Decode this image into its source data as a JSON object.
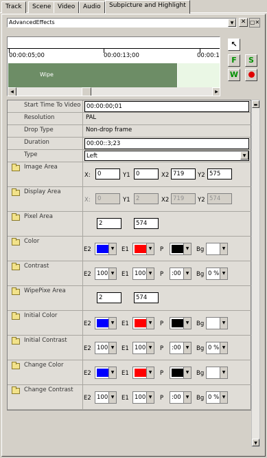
{
  "tabs": [
    "Track",
    "Scene",
    "Video",
    "Audio",
    "Subpicture and Highlight"
  ],
  "effect_select": "AdvancedEffects",
  "timeline": {
    "labels": [
      "00:00:05;00",
      "00:00:13;00",
      "00:00:1"
    ],
    "clip_label": "Wipe"
  },
  "tools": {
    "f": "F",
    "s": "S",
    "w": "W"
  },
  "props": {
    "start_label": "Start Time To Video",
    "start_value": "00:00:00;01",
    "resolution_label": "Resolution",
    "resolution_value": "PAL",
    "drop_label": "Drop Type",
    "drop_value": "Non-drop frame",
    "duration_label": "Duration",
    "duration_value": "00:00::3;23",
    "type_label": "Type",
    "type_value": "Left",
    "image_area": "Image Area",
    "display_area": "Display Area",
    "pixel_area": "Pixel Area",
    "color": "Color",
    "contrast": "Contrast",
    "wipe_pixel": "WipePixe Area",
    "initial_color": "Initial Color",
    "initial_contrast": "Initial Contrast",
    "change_color": "Change Color",
    "change_contrast": "Change Contrast"
  },
  "coords": {
    "x": "X:",
    "y1": "Y1",
    "x2": "X2",
    "y2": "Y2"
  },
  "image_area_vals": [
    "0",
    "0",
    "719",
    "575"
  ],
  "display_area_vals": [
    "0",
    "2",
    "719",
    "574"
  ],
  "pixel_area_vals": [
    "2",
    "574"
  ],
  "wipe_area_vals": [
    "2",
    "574"
  ],
  "color_labels": {
    "e2": "E2",
    "e1": "E1",
    "p": "P",
    "bg": "Bg"
  },
  "colors": {
    "e2": "#0000ff",
    "e1": "#ff0000",
    "p": "#000000",
    "bg": "#ffffff"
  },
  "contrast_vals": {
    "e2": "100",
    "e1": "100",
    "p": ":00",
    "bg": "0 %"
  }
}
